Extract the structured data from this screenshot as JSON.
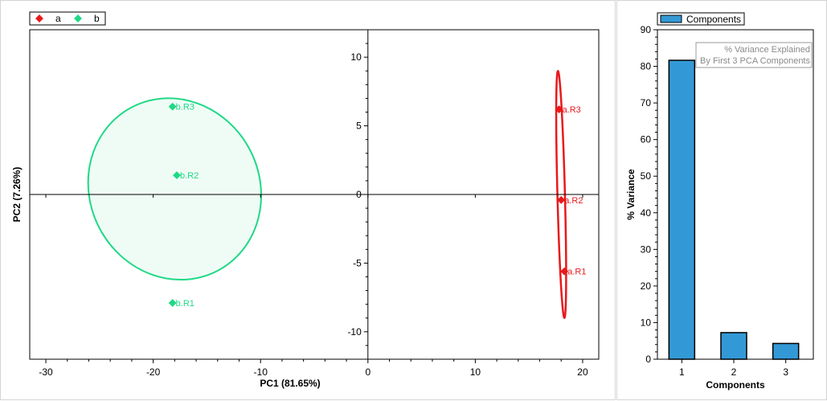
{
  "colors": {
    "group_a": "#e8191b",
    "group_b": "#1fd985",
    "bar_fill": "#3399d6",
    "axis": "#000000"
  },
  "chart_data": [
    {
      "type": "scatter",
      "xlabel": "PC1 (81.65%)",
      "ylabel": "PC2 (7.26%)",
      "xlim": [
        -31.5,
        21.5
      ],
      "ylim": [
        -12,
        12
      ],
      "xticks": [
        -30,
        -20,
        -10,
        0,
        10,
        20
      ],
      "yticks": [
        10,
        5,
        0,
        -5,
        -10
      ],
      "grid": false,
      "legend_position": "top-left",
      "series": [
        {
          "name": "a",
          "color": "#e8191b",
          "points": [
            {
              "label": "a.R1",
              "x": 18.3,
              "y": -5.6
            },
            {
              "label": "a.R2",
              "x": 18.0,
              "y": -0.4
            },
            {
              "label": "a.R3",
              "x": 17.8,
              "y": 6.2
            }
          ]
        },
        {
          "name": "b",
          "color": "#1fd985",
          "points": [
            {
              "label": "b.R1",
              "x": -18.2,
              "y": -7.9
            },
            {
              "label": "b.R2",
              "x": -17.8,
              "y": 1.4
            },
            {
              "label": "b.R3",
              "x": -18.2,
              "y": 6.4
            }
          ]
        }
      ],
      "confidence_ellipses": [
        {
          "series": "a",
          "center": [
            18.0,
            0.0
          ],
          "semi_major": 9.0,
          "semi_minor": 0.35,
          "orientation": "near vertical"
        },
        {
          "series": "b",
          "center": [
            -18.0,
            0.4
          ],
          "semi_major": 8.2,
          "semi_minor": 7.9,
          "orientation": "tilted"
        }
      ]
    },
    {
      "type": "bar",
      "categories": [
        "1",
        "2",
        "3"
      ],
      "series": [
        {
          "name": "Components",
          "values": [
            81.65,
            7.26,
            4.3
          ]
        }
      ],
      "xlabel": "Components",
      "ylabel": "% Variance",
      "ylim": [
        0,
        90
      ],
      "yticks": [
        0,
        10,
        20,
        30,
        40,
        50,
        60,
        70,
        80,
        90
      ],
      "annotation": [
        "% Variance Explained",
        "By First 3 PCA Components"
      ],
      "legend_position": "top-left"
    }
  ]
}
